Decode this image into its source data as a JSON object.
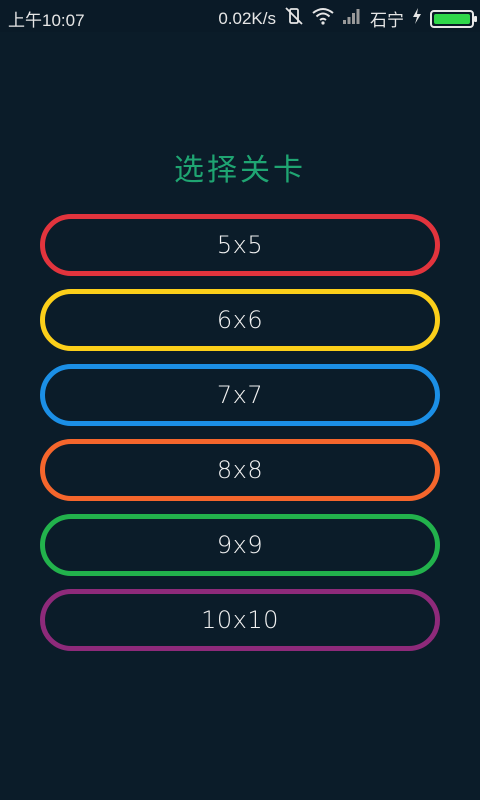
{
  "status_bar": {
    "time": "上午10:07",
    "network_speed": "0.02K/s",
    "carrier": "石宁",
    "icons": [
      "vibrate-off-icon",
      "wifi-icon",
      "signal-icon",
      "charging-icon",
      "battery-icon"
    ],
    "battery_level": 1.0,
    "battery_color": "#2fd84a"
  },
  "title": "选择关卡",
  "title_color": "#1fa572",
  "levels": [
    {
      "label": "5x5",
      "color": "#e2343d"
    },
    {
      "label": "6x6",
      "color": "#fccf1a"
    },
    {
      "label": "7x7",
      "color": "#1b8fe6"
    },
    {
      "label": "8x8",
      "color": "#f5662c"
    },
    {
      "label": "9x9",
      "color": "#22b24c"
    },
    {
      "label": "10x10",
      "color": "#8e2a7a"
    }
  ]
}
